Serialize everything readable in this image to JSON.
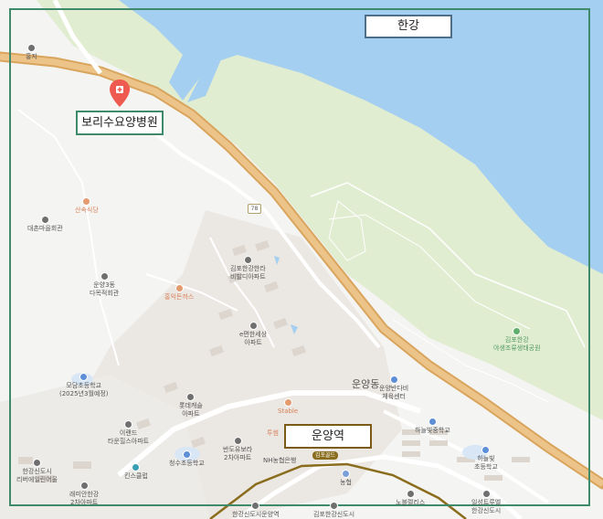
{
  "map": {
    "labels": {
      "river": "한강",
      "hospital": "보리수요양병원",
      "station": "운양역"
    },
    "area_names": {
      "unyang_dong": "운양동"
    },
    "road_shield": "78",
    "station_chip": "김포골드",
    "pois": {
      "hongji": "홍지",
      "sansog_sikdang": "산속식당",
      "daechon_maeul": "대촌마을회관",
      "unyang3_dong": "운양3동\n다목적회관",
      "honggi_sonhwas": "홍익돈까스",
      "hanra_villa": "김포한강한라\n비발디아파트",
      "e_pyeonhan": "e편한세상\n아파트",
      "modam_school": "모담초등학교\n(2025년3월예정)",
      "lotte_castle": "롯데캐슬\n아파트",
      "ilan_tower": "이랜드\n타운힐스아파트",
      "banjae_2": "반도유보라\n2차아파트",
      "cheongsu_school": "청수초등학교",
      "kids_club": "킨스클럽",
      "riverside_apt": "한강신도시\n리버에일린어울",
      "raeian_2": "래미안한강\n2차아파트",
      "stable": "Stable",
      "tuseom": "투썸",
      "nh_bank": "NH농협은행",
      "nonghyup": "농협",
      "sports_center": "운양반다비\n체육센터",
      "haneulbit_middle": "하늘빛중학교",
      "haneulbit_elem": "하늘빛\n초등학교",
      "eco_park": "김포한강\n야생조류생태공원",
      "nobel_cliniс": "노블렐리스",
      "ilsung_true": "일성트루엘\n한강신도시",
      "unyang_station_bottom": "한강신도시운양역",
      "gimpo_hangang_bottom": "김포한강신도시"
    },
    "colors": {
      "water": "#a5cff0",
      "park": "#e0edd0",
      "land": "#f4f4f2",
      "highway": "#e6b877",
      "frame": "#3f8a6a",
      "pin": "#ee5a4f"
    }
  }
}
